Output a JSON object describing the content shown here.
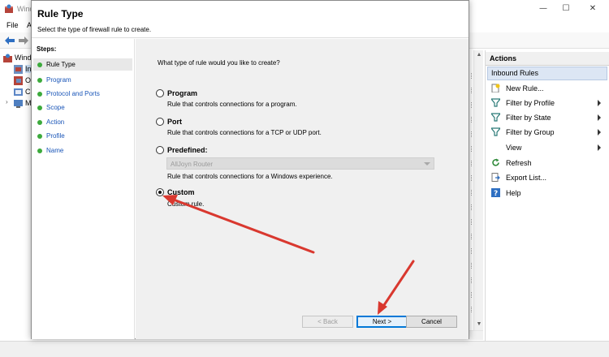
{
  "background_window": {
    "title": "Wind",
    "menu": [
      "File",
      "A"
    ],
    "tree_items": [
      {
        "label": "Wind",
        "icon": "firewall-icon"
      },
      {
        "label": "In",
        "icon": "inbound-rules-icon"
      },
      {
        "label": "O",
        "icon": "outbound-rules-icon"
      },
      {
        "label": "C",
        "icon": "connection-security-icon"
      },
      {
        "label": "M",
        "icon": "monitoring-icon"
      }
    ]
  },
  "actions": {
    "header": "Actions",
    "section": "Inbound Rules",
    "items": [
      {
        "label": "New Rule...",
        "icon": "new-rule-icon",
        "submenu": false
      },
      {
        "label": "Filter by Profile",
        "icon": "filter-icon",
        "submenu": true
      },
      {
        "label": "Filter by State",
        "icon": "filter-icon",
        "submenu": true
      },
      {
        "label": "Filter by Group",
        "icon": "filter-icon",
        "submenu": true
      },
      {
        "label": "View",
        "icon": "",
        "submenu": true
      },
      {
        "label": "Refresh",
        "icon": "refresh-icon",
        "submenu": false
      },
      {
        "label": "Export List...",
        "icon": "export-icon",
        "submenu": false
      },
      {
        "label": "Help",
        "icon": "help-icon",
        "submenu": false
      }
    ]
  },
  "wizard": {
    "title": "Rule Type",
    "subtitle": "Select the type of firewall rule to create.",
    "steps_label": "Steps:",
    "steps": [
      "Rule Type",
      "Program",
      "Protocol and Ports",
      "Scope",
      "Action",
      "Profile",
      "Name"
    ],
    "current_step": "Rule Type",
    "question": "What type of rule would you like to create?",
    "options": [
      {
        "label": "Program",
        "desc": "Rule that controls connections for a program.",
        "checked": false
      },
      {
        "label": "Port",
        "desc": "Rule that controls connections for a TCP or UDP port.",
        "checked": false
      },
      {
        "label": "Predefined:",
        "desc": "Rule that controls connections for a Windows experience.",
        "checked": false
      },
      {
        "label": "Custom",
        "desc": "Custom rule.",
        "checked": true
      }
    ],
    "predefined_value": "AllJoyn Router",
    "buttons": {
      "back": "< Back",
      "next": "Next >",
      "cancel": "Cancel"
    }
  },
  "colors": {
    "annotation_arrow": "#d9382f",
    "step_dot": "#3caa3c",
    "step_link": "#1a56b8",
    "selected_section": "#dce6f4"
  }
}
